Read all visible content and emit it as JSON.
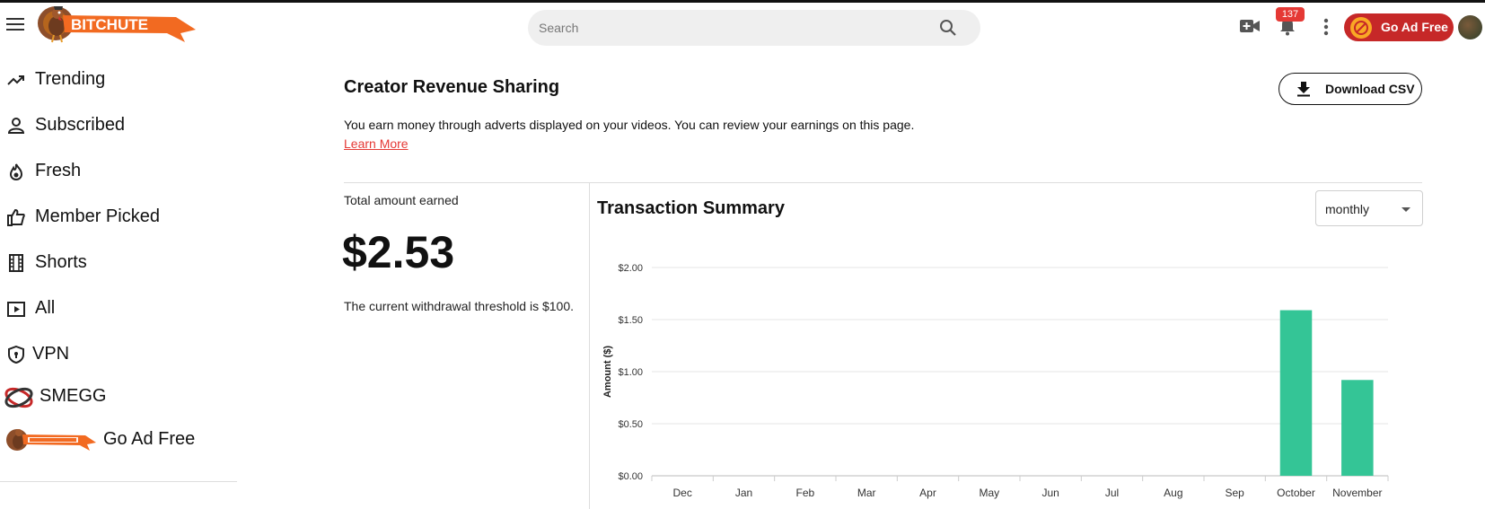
{
  "header": {
    "logo_text": "BITCHUTE",
    "search": {
      "placeholder": "Search"
    },
    "notifications_count": "137",
    "go_ad_free_label": "Go Ad Free"
  },
  "sidebar": {
    "items": [
      {
        "label": "Trending",
        "icon": "trending-icon"
      },
      {
        "label": "Subscribed",
        "icon": "person-icon"
      },
      {
        "label": "Fresh",
        "icon": "flame-icon"
      },
      {
        "label": "Member Picked",
        "icon": "thumbs-up-icon"
      },
      {
        "label": "Shorts",
        "icon": "film-icon"
      },
      {
        "label": "All",
        "icon": "play-square-icon"
      },
      {
        "label": "VPN",
        "icon": "shield-icon"
      },
      {
        "label": "SMEGG",
        "icon": "smegg-icon"
      },
      {
        "label": "Go Ad Free",
        "icon": "bitchute-logo-icon"
      }
    ]
  },
  "main": {
    "title": "Creator Revenue Sharing",
    "download_label": "Download CSV",
    "intro_text": "You earn money through adverts displayed on your videos. You can review your earnings on this page.",
    "learn_more": "Learn More",
    "total_label": "Total amount earned",
    "total_amount": "$2.53",
    "threshold_text": "The current withdrawal threshold is $100.",
    "summary_title": "Transaction Summary",
    "period_value": "monthly"
  },
  "colors": {
    "accent_red": "#c62828",
    "link_red": "#e53935",
    "bar_green": "#34c596",
    "logo_orange": "#f26a21"
  },
  "chart_data": {
    "type": "bar",
    "categories": [
      "Dec",
      "Jan",
      "Feb",
      "Mar",
      "Apr",
      "May",
      "Jun",
      "Jul",
      "Aug",
      "Sep",
      "October",
      "November"
    ],
    "values": [
      0,
      0,
      0,
      0,
      0,
      0,
      0,
      0,
      0,
      0,
      1.59,
      0.92
    ],
    "ylabel": "Amount ($)",
    "ylim": [
      0,
      2
    ],
    "yticks": [
      "$0.00",
      "$0.50",
      "$1.00",
      "$1.50",
      "$2.00"
    ],
    "ytick_values": [
      0,
      0.5,
      1,
      1.5,
      2
    ],
    "grid": true
  }
}
